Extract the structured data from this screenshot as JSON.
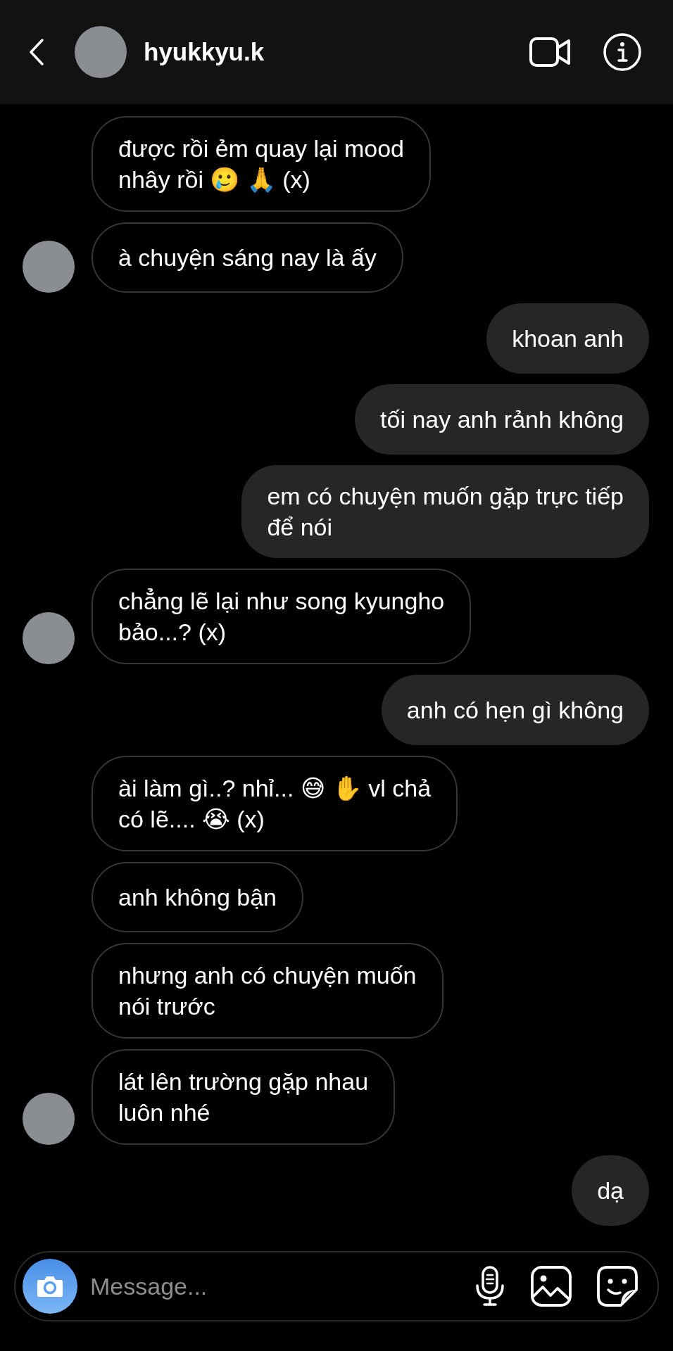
{
  "header": {
    "username": "hyukkyu.k"
  },
  "messages": [
    {
      "kind": "incoming",
      "avatar": false,
      "text": "được rồi ẻm quay lại mood\nnhây rồi 🥲 🙏 (x)"
    },
    {
      "kind": "incoming",
      "avatar": true,
      "text": "à chuyện sáng nay là ấy"
    },
    {
      "kind": "outgoing",
      "avatar": false,
      "text": "khoan anh"
    },
    {
      "kind": "outgoing",
      "avatar": false,
      "text": "tối nay anh rảnh không"
    },
    {
      "kind": "outgoing",
      "avatar": false,
      "text": "em có chuyện muốn gặp trực tiếp\nđể nói"
    },
    {
      "kind": "incoming",
      "avatar": true,
      "text": "chẳng lẽ lại như song kyungho\nbảo...? (x)"
    },
    {
      "kind": "outgoing",
      "avatar": false,
      "text": "anh có hẹn gì không"
    },
    {
      "kind": "incoming",
      "avatar": false,
      "text": "ài làm gì..? nhỉ... 😅 ✋ vl chả\ncó lẽ.... 😭  (x)"
    },
    {
      "kind": "incoming",
      "avatar": false,
      "text": "anh không bận"
    },
    {
      "kind": "incoming",
      "avatar": false,
      "text": "nhưng anh có chuyện muốn\nnói trước"
    },
    {
      "kind": "incoming",
      "avatar": true,
      "text": "lát lên trường gặp nhau\nluôn nhé"
    },
    {
      "kind": "outgoing",
      "avatar": false,
      "text": "dạ"
    }
  ],
  "composer": {
    "placeholder": "Message..."
  }
}
